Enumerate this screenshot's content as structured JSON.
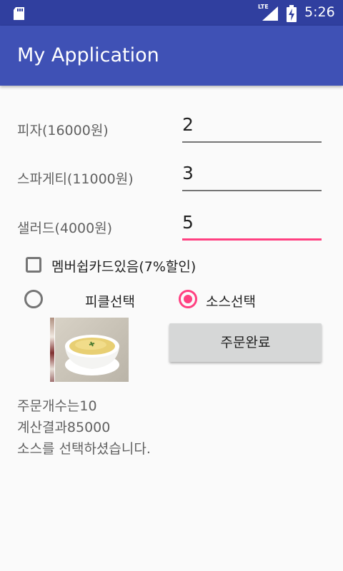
{
  "status_bar": {
    "network": "LTE",
    "time": "5:26"
  },
  "app": {
    "title": "My Application"
  },
  "order_items": [
    {
      "label": "피자(16000원)",
      "quantity": "2"
    },
    {
      "label": "스파게티(11000원)",
      "quantity": "3"
    },
    {
      "label": "샐러드(4000원)",
      "quantity": "5"
    }
  ],
  "membership": {
    "label": "멤버쉽카드있음(7%할인)",
    "checked": false
  },
  "options": {
    "pickle": {
      "label": "피클선택",
      "selected": false
    },
    "sauce": {
      "label": "소스선택",
      "selected": true
    }
  },
  "image": {
    "icon": "sauce-cup-image"
  },
  "complete_button": {
    "label": "주문완료"
  },
  "results": {
    "count": "주문개수는10",
    "total": "계산결과85000",
    "selection": "소스를 선택하셨습니다."
  },
  "colors": {
    "primary": "#3f51b5",
    "primary_dark": "#303f9f",
    "accent": "#ff4081"
  }
}
